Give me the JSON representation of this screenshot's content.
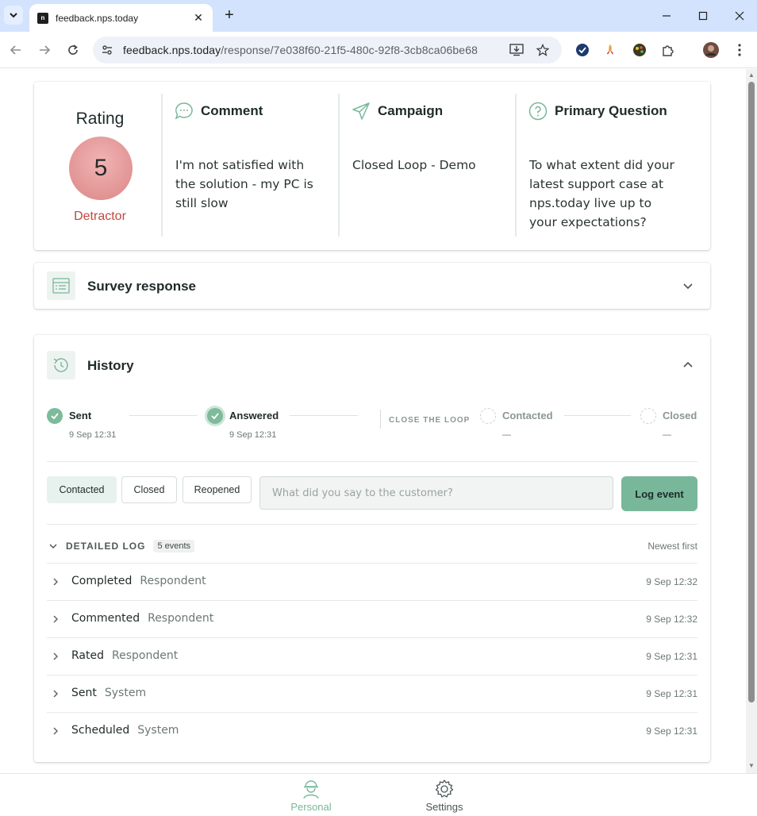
{
  "browser": {
    "tab_title": "feedback.nps.today",
    "url_host": "feedback.nps.today",
    "url_path": "/response/7e038f60-21f5-480c-92f8-3cb8ca06be68"
  },
  "summary": {
    "rating_title": "Rating",
    "rating_value": "5",
    "rating_category": "Detractor",
    "comment_label": "Comment",
    "comment_text": "I'm not satisfied with the solution - my PC is still slow",
    "campaign_label": "Campaign",
    "campaign_text": "Closed Loop - Demo",
    "question_label": "Primary Question",
    "question_text": "To what extent did your latest support case at nps.today live up to your expectations?"
  },
  "survey_section": {
    "title": "Survey response"
  },
  "history": {
    "title": "History",
    "steps": [
      {
        "label": "Sent",
        "time": "9 Sep 12:31",
        "done": true
      },
      {
        "label": "Answered",
        "time": "9 Sep 12:31",
        "done": true
      },
      {
        "label": "Contacted",
        "time": "—",
        "done": false
      },
      {
        "label": "Closed",
        "time": "—",
        "done": false
      }
    ],
    "close_loop_label": "CLOSE THE LOOP",
    "action_pills": [
      "Contacted",
      "Closed",
      "Reopened"
    ],
    "input_placeholder": "What did you say to the customer?",
    "log_button": "Log event",
    "detailed_log": {
      "title": "DETAILED LOG",
      "count": "5 events",
      "sort": "Newest first",
      "events": [
        {
          "event": "Completed",
          "actor": "Respondent",
          "time": "9 Sep 12:32"
        },
        {
          "event": "Commented",
          "actor": "Respondent",
          "time": "9 Sep 12:32"
        },
        {
          "event": "Rated",
          "actor": "Respondent",
          "time": "9 Sep 12:31"
        },
        {
          "event": "Sent",
          "actor": "System",
          "time": "9 Sep 12:31"
        },
        {
          "event": "Scheduled",
          "actor": "System",
          "time": "9 Sep 12:31"
        }
      ]
    }
  },
  "bottom_nav": {
    "items": [
      {
        "label": "Personal",
        "icon": "user-hardhat-icon",
        "active": true
      },
      {
        "label": "Settings",
        "icon": "gear-icon",
        "active": false
      }
    ]
  },
  "colors": {
    "accent": "#79b79a",
    "detractor": "#c1473f",
    "rating_circle": "#e39696",
    "chrome_tabbar": "#d3e3fd"
  }
}
